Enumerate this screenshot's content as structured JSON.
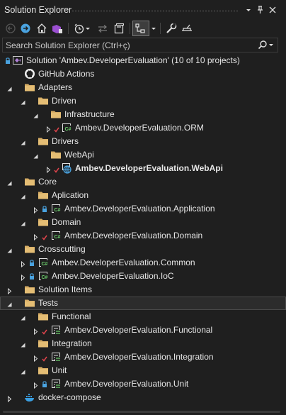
{
  "window": {
    "title": "Solution Explorer",
    "controls": [
      "dropdown",
      "pin",
      "close"
    ]
  },
  "toolbar": {
    "buttons": [
      "back",
      "forward",
      "home",
      "switch-views",
      "pending-changes-filter",
      "sync",
      "collapse-all",
      "show-all-files",
      "properties",
      "preview"
    ]
  },
  "search": {
    "placeholder": "Search Solution Explorer (Ctrl+ç)"
  },
  "tree": [
    {
      "label": "Solution 'Ambev.DeveloperEvaluation' (10 of 10 projects)",
      "icon": "solution-icon",
      "lock": true
    },
    {
      "label": "GitHub Actions",
      "icon": "github-icon"
    },
    {
      "label": "Adapters",
      "icon": "folder-icon",
      "expanded": true
    },
    {
      "label": "Driven",
      "icon": "folder-icon",
      "expanded": true
    },
    {
      "label": "Infrastructure",
      "icon": "folder-icon",
      "expanded": true
    },
    {
      "label": "Ambev.DeveloperEvaluation.ORM",
      "icon": "csharp-project-icon",
      "collapsed": true,
      "check": true
    },
    {
      "label": "Drivers",
      "icon": "folder-icon",
      "expanded": true
    },
    {
      "label": "WebApi",
      "icon": "folder-icon",
      "expanded": true
    },
    {
      "label": "Ambev.DeveloperEvaluation.WebApi",
      "icon": "web-project-icon",
      "collapsed": true,
      "check": true,
      "bold": true
    },
    {
      "label": "Core",
      "icon": "folder-icon",
      "expanded": true
    },
    {
      "label": "Aplication",
      "icon": "folder-icon",
      "expanded": true
    },
    {
      "label": "Ambev.DeveloperEvaluation.Application",
      "icon": "csharp-project-icon",
      "collapsed": true,
      "lock": true
    },
    {
      "label": "Domain",
      "icon": "folder-icon",
      "expanded": true
    },
    {
      "label": "Ambev.DeveloperEvaluation.Domain",
      "icon": "csharp-project-icon",
      "collapsed": true,
      "check": true
    },
    {
      "label": "Crosscutting",
      "icon": "folder-icon",
      "expanded": true
    },
    {
      "label": "Ambev.DeveloperEvaluation.Common",
      "icon": "csharp-project-icon",
      "collapsed": true,
      "lock": true
    },
    {
      "label": "Ambev.DeveloperEvaluation.IoC",
      "icon": "csharp-project-icon",
      "collapsed": true,
      "lock": true
    },
    {
      "label": "Solution Items",
      "icon": "folder-icon",
      "collapsed": true
    },
    {
      "label": "Tests",
      "icon": "folder-icon",
      "expanded": true,
      "selected": true
    },
    {
      "label": "Functional",
      "icon": "folder-icon",
      "expanded": true
    },
    {
      "label": "Ambev.DeveloperEvaluation.Functional",
      "icon": "test-project-icon",
      "collapsed": true,
      "check": true
    },
    {
      "label": "Integration",
      "icon": "folder-icon",
      "expanded": true
    },
    {
      "label": "Ambev.DeveloperEvaluation.Integration",
      "icon": "test-project-icon",
      "collapsed": true,
      "check": true
    },
    {
      "label": "Unit",
      "icon": "folder-icon",
      "expanded": true
    },
    {
      "label": "Ambev.DeveloperEvaluation.Unit",
      "icon": "test-project-icon",
      "collapsed": true,
      "lock": true
    },
    {
      "label": "docker-compose",
      "icon": "docker-icon",
      "collapsed": true
    }
  ]
}
